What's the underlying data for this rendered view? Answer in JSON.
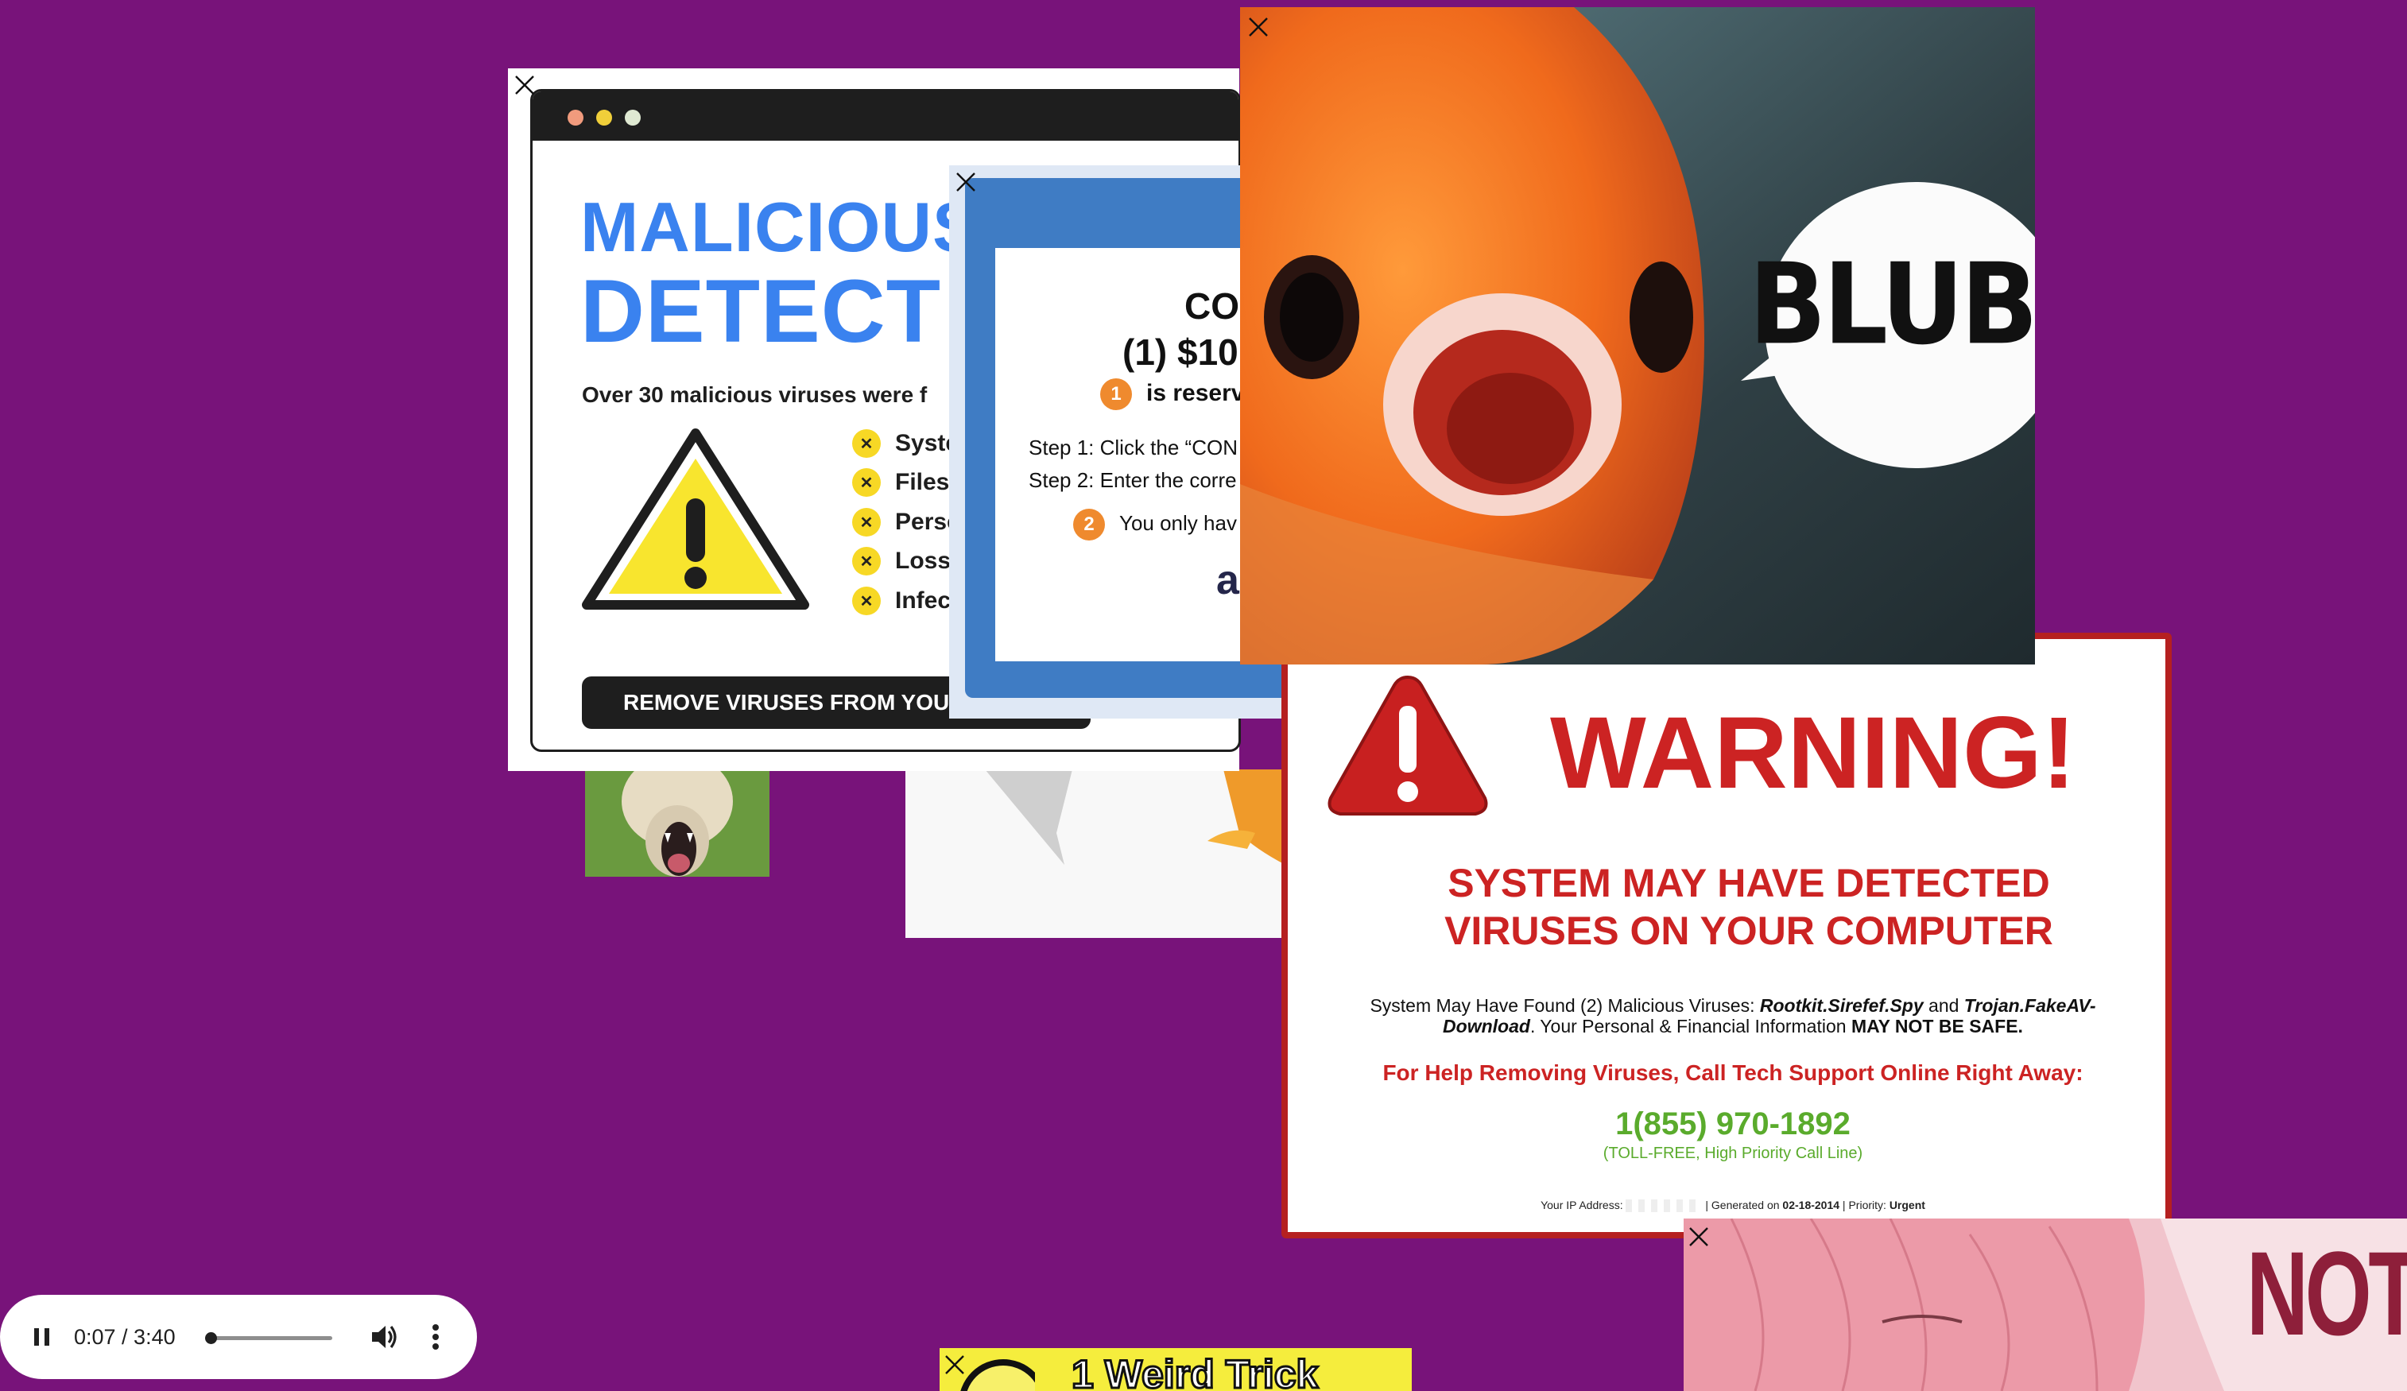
{
  "colors": {
    "background": "#78137a",
    "warning_red": "#cc2323",
    "phone_green": "#5aab2c",
    "malicious_blue": "#3a82ef"
  },
  "popup_malicious": {
    "headline_1": "MALICIOUS",
    "headline_2": "DETECT",
    "subtitle_prefix": "Over ",
    "subtitle_count": "30 malicious viruses",
    "subtitle_suffix": " were f",
    "bullets": [
      "System",
      "Files d",
      "Person",
      "Loss o",
      "Infecti"
    ],
    "bullet_icon": "x-circle-icon",
    "button_label": "REMOVE VIRUSES FROM YOU"
  },
  "popup_coupon": {
    "title_1": "CO",
    "title_2": "(1) $10",
    "reserved_num": "1",
    "reserved_text": "is reserv",
    "step_1": "Step 1: Click the “CON",
    "step_2": "Step 2: Enter the corre",
    "only_num": "2",
    "only_text": "You only hav",
    "trailing": "a"
  },
  "popup_fish": {
    "speech": "BLUB"
  },
  "popup_warning": {
    "title": "WARNING!",
    "subtitle_1": "SYSTEM MAY HAVE DETECTED",
    "subtitle_2": "VIRUSES ON YOUR COMPUTER",
    "body_1a": "System May Have Found (2) Malicious Viruses: ",
    "body_1b": "Rootkit.Sirefef.Spy",
    "body_1c": " and ",
    "body_1d": "Trojan.FakeAV-",
    "body_2a": "Download",
    "body_2b": ". Your Personal & Financial Information ",
    "body_2c": "MAY NOT BE SAFE.",
    "help_text": "For Help Removing Viruses, Call Tech Support Online Right Away:",
    "phone": "1(855) 970-1892",
    "phone_note": "(TOLL-FREE, High Priority Call Line)",
    "footer_ip_label": "Your IP Address:",
    "footer_generated": "| Generated on ",
    "footer_date": "02-18-2014",
    "footer_priority": " | Priority: ",
    "footer_priority_value": "Urgent"
  },
  "anime_banner": {
    "text": "NOT"
  },
  "weird_banner": {
    "text": "1 Weird Trick"
  },
  "video_player": {
    "time": "0:07 / 3:40",
    "progress_fraction": 0.032,
    "volume_fraction": 1.0
  }
}
